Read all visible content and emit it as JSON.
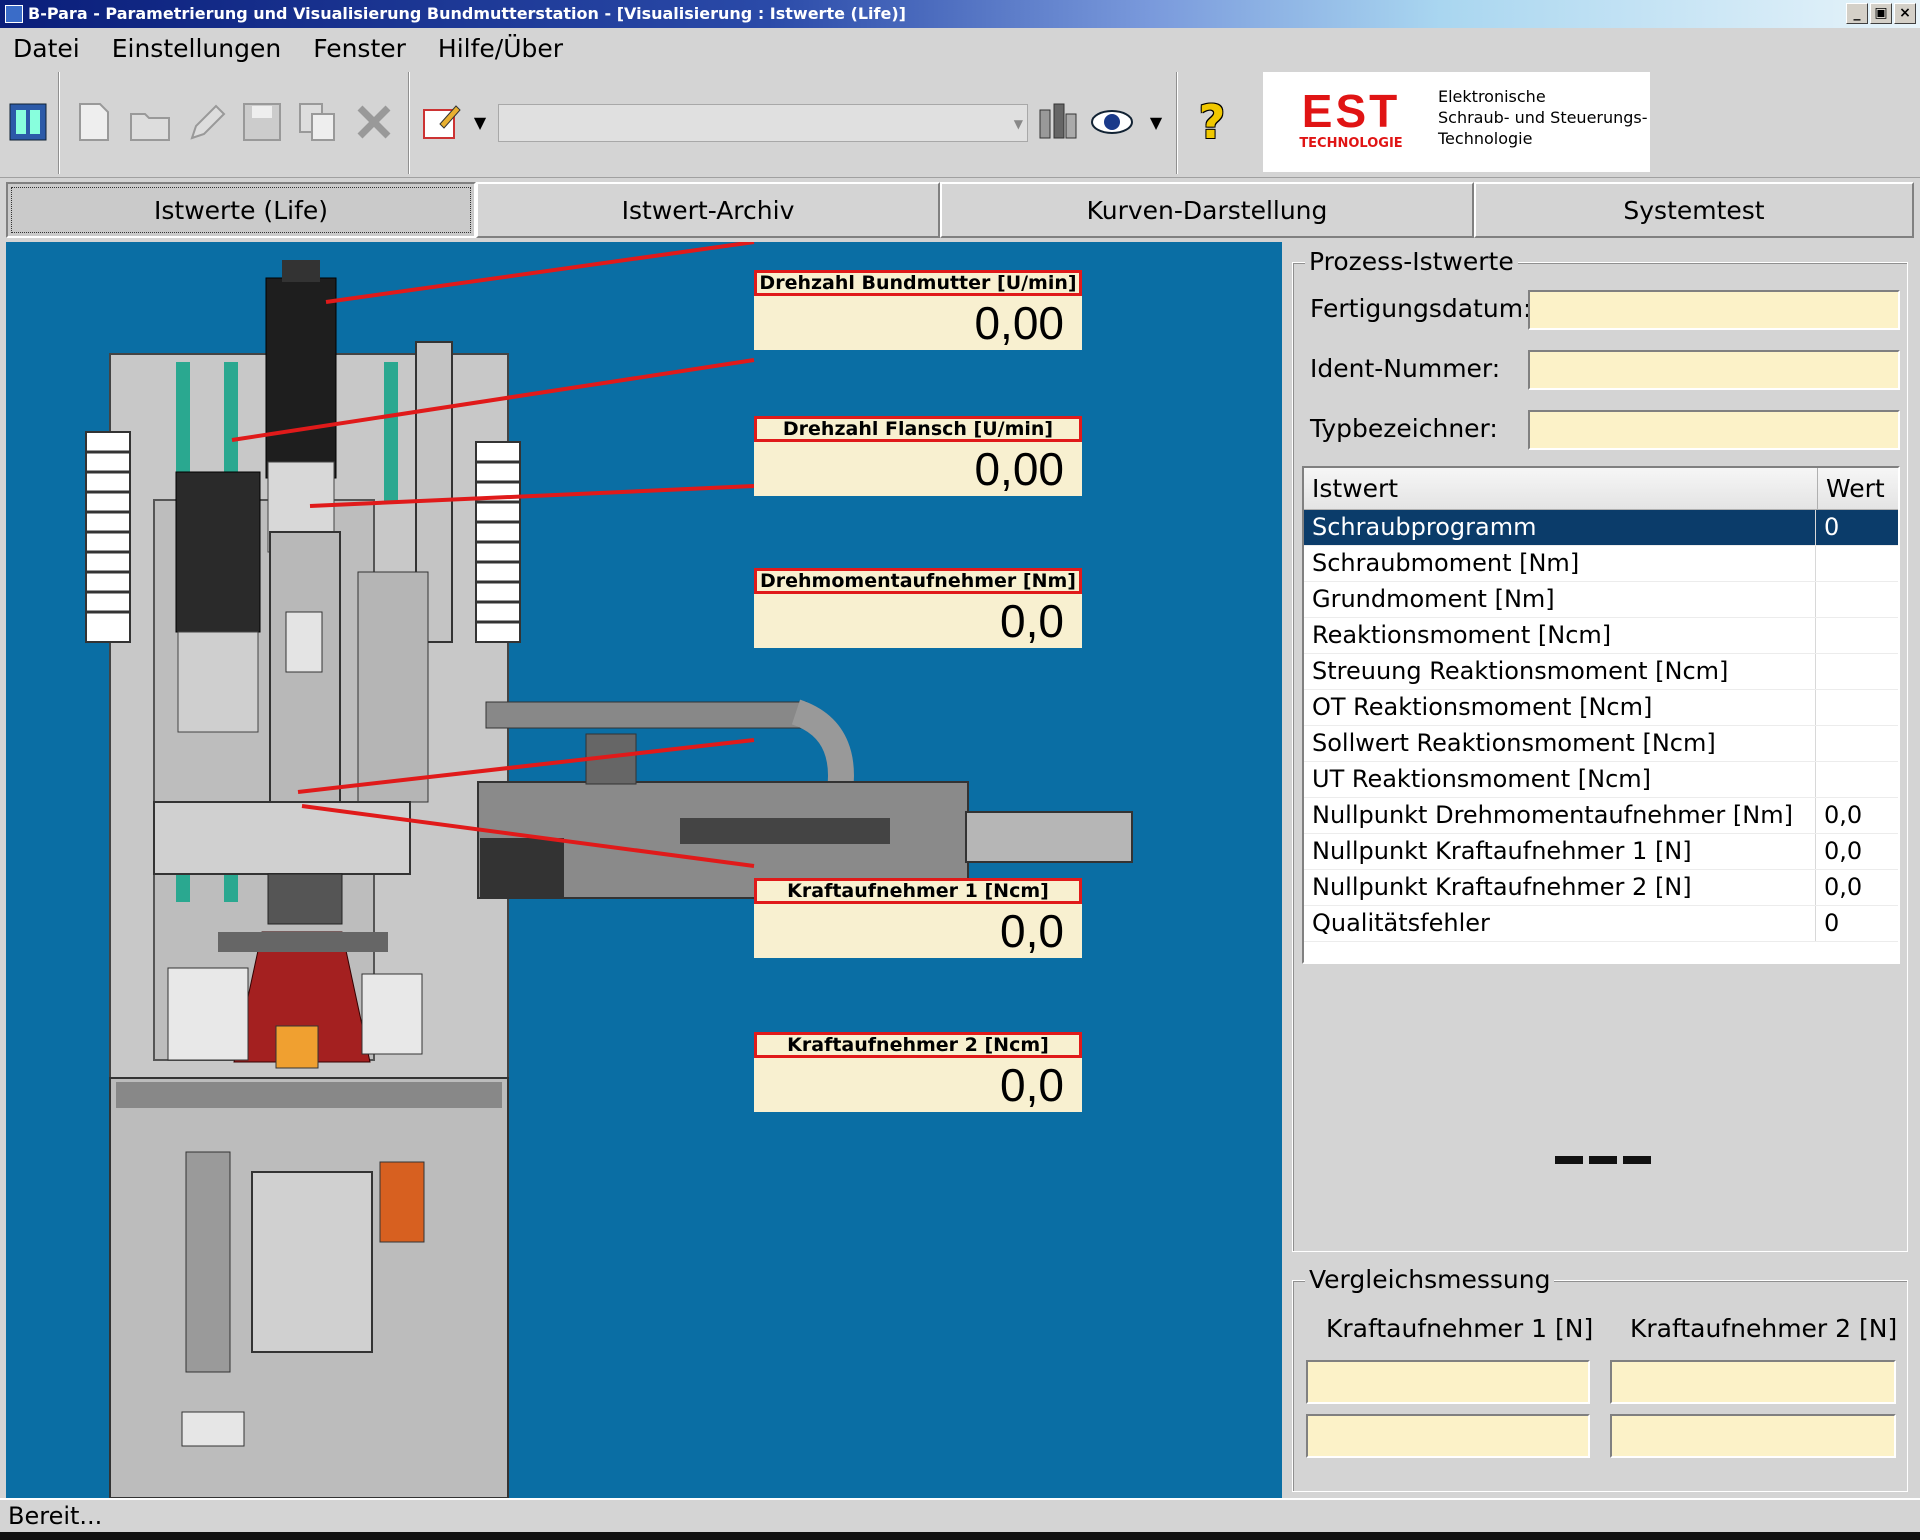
{
  "window": {
    "title": "B-Para - Parametrierung und Visualisierung Bundmutterstation - [Visualisierung : Istwerte (Life)]",
    "buttons": [
      "_",
      "▣",
      "×"
    ]
  },
  "menu": [
    "Datei",
    "Einstellungen",
    "Fenster",
    "Hilfe/Über"
  ],
  "toolbar": {
    "combo_value": "",
    "icons": [
      "station-icon",
      "new-file-icon",
      "open-folder-icon",
      "edit-pencil-icon",
      "save-icon",
      "copy-icon",
      "delete-icon",
      "notepad-icon",
      "device-icon",
      "eye-icon",
      "help-icon"
    ]
  },
  "logo": {
    "brand": "EST",
    "sub": "TECHNOLOGIE",
    "line1": "Elektronische",
    "line2": "Schraub- und Steuerungs-",
    "line3": "Technologie"
  },
  "tabs": [
    "Istwerte (Life)",
    "Istwert-Archiv",
    "Kurven-Darstellung",
    "Systemtest"
  ],
  "gauges": [
    {
      "label": "Drehzahl Bundmutter [U/min]",
      "value": "0,00"
    },
    {
      "label": "Drehzahl Flansch [U/min]",
      "value": "0,00"
    },
    {
      "label": "Drehmomentaufnehmer [Nm]",
      "value": "0,0"
    },
    {
      "label": "Kraftaufnehmer 1 [Ncm]",
      "value": "0,0"
    },
    {
      "label": "Kraftaufnehmer 2 [Ncm]",
      "value": "0,0"
    }
  ],
  "process": {
    "title": "Prozess-Istwerte",
    "fields": [
      {
        "label": "Fertigungsdatum:",
        "value": ""
      },
      {
        "label": "Ident-Nummer:",
        "value": ""
      },
      {
        "label": "Typbezeichner:",
        "value": ""
      }
    ]
  },
  "table": {
    "headers": [
      "Istwert",
      "Wert"
    ],
    "rows": [
      {
        "name": "Schraubprogramm",
        "value": "0"
      },
      {
        "name": "Schraubmoment [Nm]",
        "value": ""
      },
      {
        "name": "Grundmoment [Nm]",
        "value": ""
      },
      {
        "name": "Reaktionsmoment [Ncm]",
        "value": ""
      },
      {
        "name": "Streuung Reaktionsmoment [Ncm]",
        "value": ""
      },
      {
        "name": "OT Reaktionsmoment [Ncm]",
        "value": ""
      },
      {
        "name": "Sollwert Reaktionsmoment [Ncm]",
        "value": ""
      },
      {
        "name": "UT Reaktionsmoment [Ncm]",
        "value": ""
      },
      {
        "name": "Nullpunkt Drehmomentaufnehmer [Nm]",
        "value": "0,0"
      },
      {
        "name": "Nullpunkt Kraftaufnehmer 1 [N]",
        "value": "0,0"
      },
      {
        "name": "Nullpunkt Kraftaufnehmer 2 [N]",
        "value": "0,0"
      },
      {
        "name": "Qualitätsfehler",
        "value": "0"
      }
    ]
  },
  "vergleich": {
    "title": "Vergleichsmessung",
    "col1": "Kraftaufnehmer 1 [N]",
    "col2": "Kraftaufnehmer 2 [N]"
  },
  "status": "Bereit..."
}
